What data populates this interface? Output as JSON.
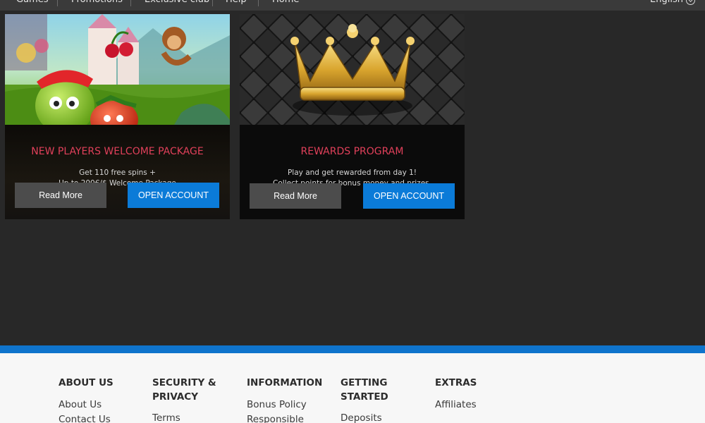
{
  "nav": {
    "items": [
      "Games",
      "Promotions",
      "Exclusive club",
      "Help",
      "Home"
    ],
    "language": "English",
    "language_icon": "chevron-down-icon"
  },
  "promos": [
    {
      "title": "NEW PLAYERS WELCOME PACKAGE",
      "desc_line1": "Get 110 free spins +",
      "desc_line2": "Up to 200€/$ Welcome Package",
      "read_more": "Read More",
      "open_account": "OPEN ACCOUNT",
      "image": "cartoon-fruit-slot-characters"
    },
    {
      "title": "REWARDS PROGRAM",
      "desc_line1": "Play and get rewarded from day 1!",
      "desc_line2": "Collect points for bonus money and prizes.",
      "read_more": "Read More",
      "open_account": "OPEN ACCOUNT",
      "image": "gold-crown-on-quilted-leather"
    }
  ],
  "footer": {
    "columns": [
      {
        "heading": "ABOUT US",
        "links": [
          "About Us",
          "Contact Us"
        ]
      },
      {
        "heading": "SECURITY & PRIVACY",
        "links": [
          "Terms"
        ]
      },
      {
        "heading": "INFORMATION",
        "links": [
          "Bonus Policy",
          "Responsible"
        ]
      },
      {
        "heading": "GETTING STARTED",
        "links": [
          "Deposits"
        ]
      },
      {
        "heading": "EXTRAS",
        "links": [
          "Affiliates"
        ]
      }
    ]
  },
  "colors": {
    "accent_blue": "#0b7bd8",
    "promo_title_red": "#e0405a",
    "page_background": "#282828",
    "footer_background": "#f7f7f7"
  }
}
